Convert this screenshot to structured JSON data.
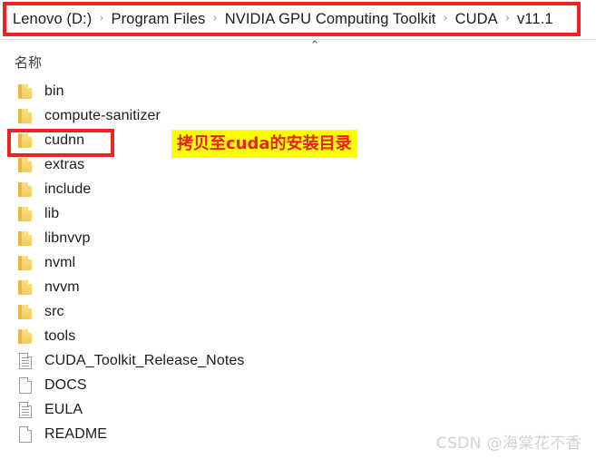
{
  "address_bar": {
    "crumbs": [
      "Lenovo (D:)",
      "Program Files",
      "NVIDIA GPU Computing Toolkit",
      "CUDA",
      "v11.1"
    ],
    "separator": "›",
    "highlight_color": "#ee2222"
  },
  "collapse_chevron": "⌃",
  "column_header": "名称",
  "files": [
    {
      "name": "bin",
      "icon": "folder-icon"
    },
    {
      "name": "compute-sanitizer",
      "icon": "folder-icon"
    },
    {
      "name": "cudnn",
      "icon": "folder-icon"
    },
    {
      "name": "extras",
      "icon": "folder-icon"
    },
    {
      "name": "include",
      "icon": "folder-icon"
    },
    {
      "name": "lib",
      "icon": "folder-icon"
    },
    {
      "name": "libnvvp",
      "icon": "folder-icon"
    },
    {
      "name": "nvml",
      "icon": "folder-icon"
    },
    {
      "name": "nvvm",
      "icon": "folder-icon"
    },
    {
      "name": "src",
      "icon": "folder-icon"
    },
    {
      "name": "tools",
      "icon": "folder-icon"
    },
    {
      "name": "CUDA_Toolkit_Release_Notes",
      "icon": "text-document-icon"
    },
    {
      "name": "DOCS",
      "icon": "blank-document-icon"
    },
    {
      "name": "EULA",
      "icon": "text-document-icon"
    },
    {
      "name": "README",
      "icon": "blank-document-icon"
    }
  ],
  "annotation": {
    "text": "拷贝至cuda的安装目录",
    "background_color": "#ffff00",
    "text_color": "#e8201b"
  },
  "cudnn_highlight": {
    "border_color": "#ee2222"
  },
  "watermark": "CSDN @海棠花不香"
}
